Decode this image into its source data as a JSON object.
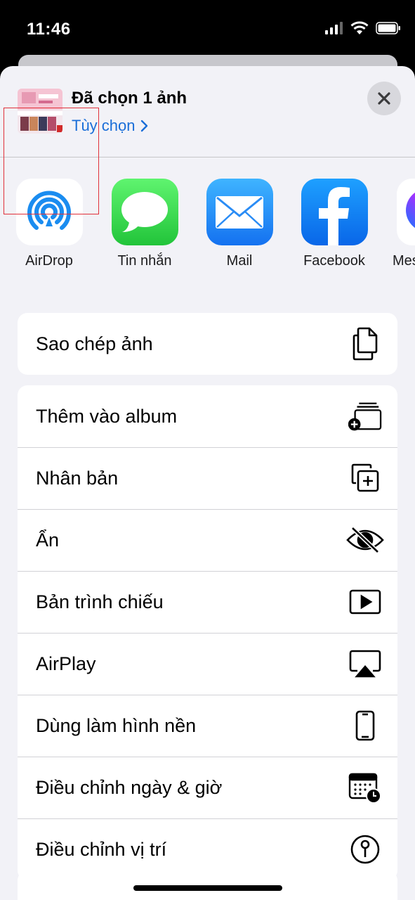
{
  "status_bar": {
    "time": "11:46"
  },
  "share_sheet": {
    "title": "Đã chọn 1 ảnh",
    "options_label": "Tùy chọn",
    "apps": [
      {
        "label": "AirDrop"
      },
      {
        "label": "Tin nhắn"
      },
      {
        "label": "Mail"
      },
      {
        "label": "Facebook"
      },
      {
        "label": "Mes"
      }
    ],
    "action_groups": [
      [
        {
          "label": "Sao chép ảnh",
          "icon": "copy-icon"
        }
      ],
      [
        {
          "label": "Thêm vào album",
          "icon": "add-to-album-icon"
        },
        {
          "label": "Nhân bản",
          "icon": "duplicate-icon"
        },
        {
          "label": "Ẩn",
          "icon": "hide-eye-icon"
        },
        {
          "label": "Bản trình chiếu",
          "icon": "slideshow-play-icon"
        },
        {
          "label": "AirPlay",
          "icon": "airplay-icon"
        },
        {
          "label": "Dùng làm hình nền",
          "icon": "phone-wallpaper-icon"
        },
        {
          "label": "Điều chỉnh ngày & giờ",
          "icon": "calendar-clock-icon"
        },
        {
          "label": "Điều chỉnh vị trí",
          "icon": "location-pin-icon"
        }
      ]
    ]
  },
  "colors": {
    "link": "#1a6ed8",
    "highlight_border": "#e0303a"
  }
}
